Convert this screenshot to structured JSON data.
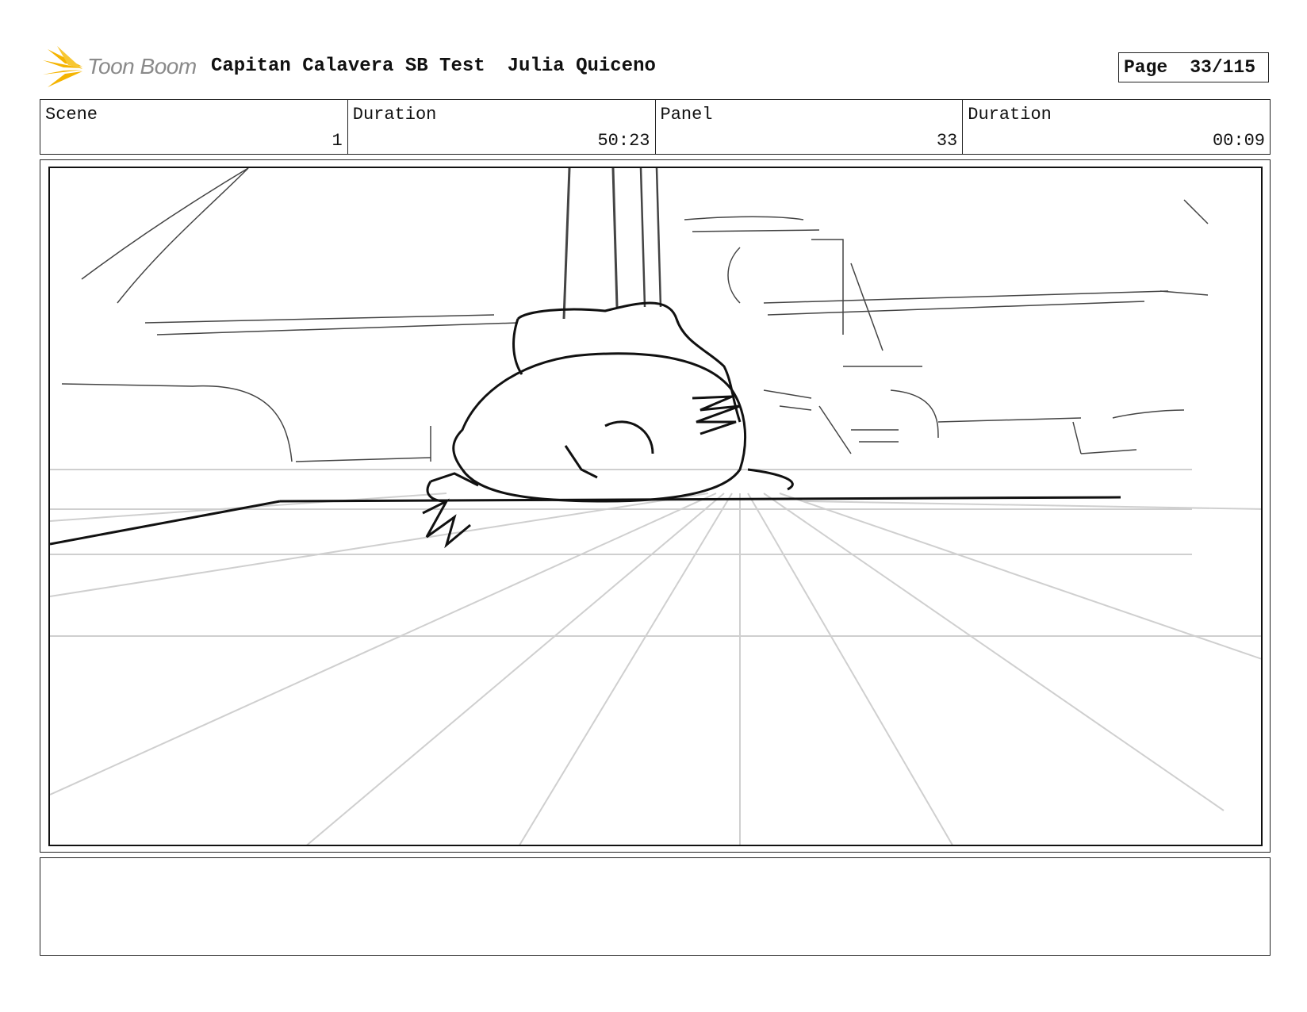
{
  "header": {
    "logo_text": "Toon Boom",
    "project_title": "Capitan Calavera SB Test",
    "author": "Julia Quiceno",
    "page_label": "Page",
    "page_number": "33/115"
  },
  "info": {
    "scene_label": "Scene",
    "scene_value": "1",
    "scene_duration_label": "Duration",
    "scene_duration_value": "50:23",
    "panel_label": "Panel",
    "panel_value": "33",
    "panel_duration_label": "Duration",
    "panel_duration_value": "00:09"
  },
  "notes": {
    "text": ""
  },
  "colors": {
    "logo_accent": "#f5b400",
    "sketch_dark": "#111111",
    "sketch_light": "#c8c8c8"
  }
}
